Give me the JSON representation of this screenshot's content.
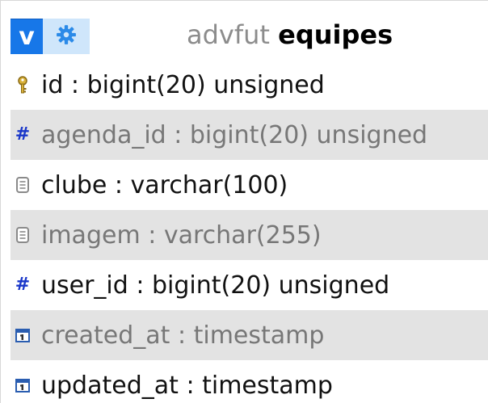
{
  "header": {
    "toggle_label": "v",
    "options_icon": "gear-icon",
    "db_name": "advfut",
    "table_name": "equipes"
  },
  "columns": [
    {
      "name": "id",
      "type": "bigint(20) unsigned",
      "icon": "key-icon"
    },
    {
      "name": "agenda_id",
      "type": "bigint(20) unsigned",
      "icon": "hash-icon"
    },
    {
      "name": "clube",
      "type": "varchar(100)",
      "icon": "text-field-icon"
    },
    {
      "name": "imagem",
      "type": "varchar(255)",
      "icon": "text-field-icon"
    },
    {
      "name": "user_id",
      "type": "bigint(20) unsigned",
      "icon": "hash-icon"
    },
    {
      "name": "created_at",
      "type": "timestamp",
      "icon": "calendar-icon"
    },
    {
      "name": "updated_at",
      "type": "timestamp",
      "icon": "calendar-icon"
    }
  ],
  "separator": " : ",
  "colors": {
    "accent": "#1777e8",
    "accent_light": "#cfe6fb",
    "alt_row": "#e3e3e3",
    "hash": "#1a37c9"
  }
}
